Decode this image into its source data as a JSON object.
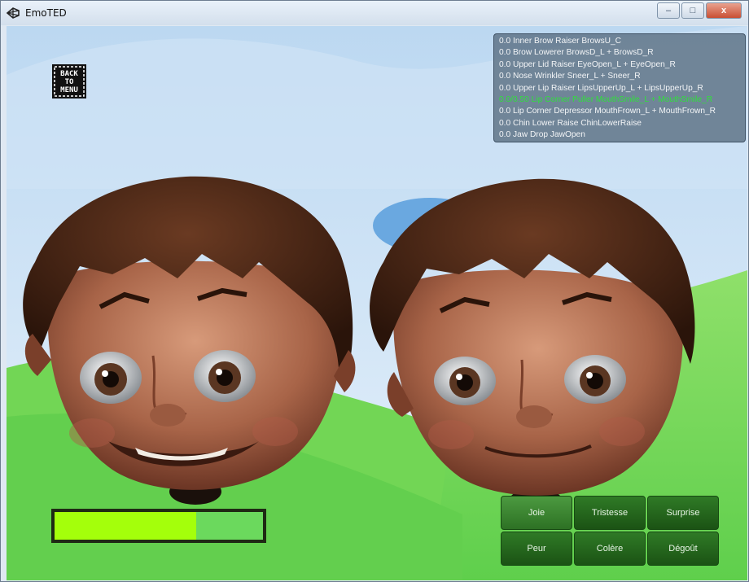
{
  "window": {
    "title": "EmoTED",
    "minimize": "–",
    "maximize": "□",
    "close": "x"
  },
  "back_button": {
    "line1": "BACK",
    "line2": "TO",
    "line3": "MENU"
  },
  "info_panel": {
    "lines": [
      "0.0 Inner Brow Raiser   BrowsU_C",
      "0.0 Brow Lowerer   BrowsD_L + BrowsD_R",
      "0.0 Upper Lid Raiser   EyeOpen_L + EyeOpen_R",
      "0.0 Nose Wrinkler   Sneer_L + Sneer_R",
      "0.0 Upper Lip Raiser   LipsUpperUp_L + LipsUpperUp_R",
      "0.0/0.50 Lip Corner Puller   MouthSmile_L + MouthSmile_R",
      "0.0 Lip Corner Depressor   MouthFrown_L + MouthFrown_R",
      "0.0 Chin Lower Raise   ChinLowerRaise",
      "0.0 Jaw Drop   JawOpen"
    ],
    "active_index": 5,
    "active_color": "#2fe03a"
  },
  "progress": {
    "value": 0.68,
    "fill_color": "#a4ff0b"
  },
  "emotions": {
    "items": [
      "Joie",
      "Tristesse",
      "Surprise",
      "Peur",
      "Colère",
      "Dégoût"
    ],
    "selected_index": 0
  }
}
